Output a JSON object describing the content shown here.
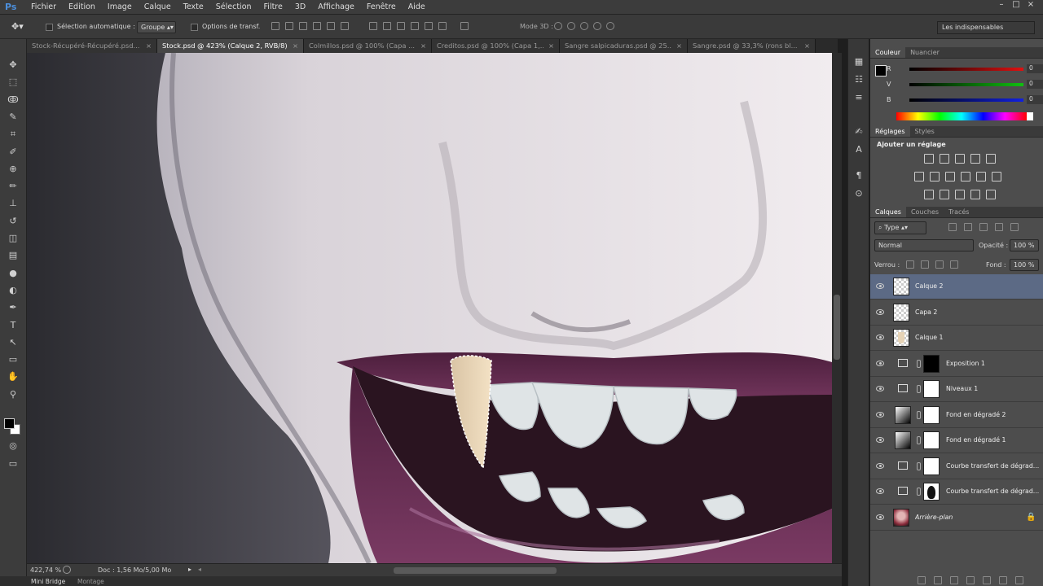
{
  "app": {
    "logo": "Ps"
  },
  "menu": [
    "Fichier",
    "Edition",
    "Image",
    "Calque",
    "Texte",
    "Sélection",
    "Filtre",
    "3D",
    "Affichage",
    "Fenêtre",
    "Aide"
  ],
  "window_controls": [
    "–",
    "□",
    "×"
  ],
  "options": {
    "auto_select_label": "Sélection automatique :",
    "auto_select_value": "Groupe",
    "transform_label": "Options de transf.",
    "mode3d_label": "Mode 3D :"
  },
  "workspace": "Les indispensables",
  "tabs": [
    {
      "label": "Stock-Récupéré-Récupéré.psd...",
      "active": false
    },
    {
      "label": "Stock.psd @ 423% (Calque 2, RVB/8) *",
      "active": true
    },
    {
      "label": "Colmillos.psd @ 100% (Capa ...",
      "active": false
    },
    {
      "label": "Creditos.psd @ 100% (Capa 1,...",
      "active": false
    },
    {
      "label": "Sangre salpicaduras.psd @ 25...",
      "active": false
    },
    {
      "label": "Sangre.psd @ 33,3% (rons bl...",
      "active": false
    }
  ],
  "status": {
    "zoom": "422,74 %",
    "doc": "Doc : 1,56 Mo/5,00 Mo"
  },
  "bottom_tabs": [
    "Mini Bridge",
    "Montage"
  ],
  "color_panel": {
    "tabs": [
      "Couleur",
      "Nuancier"
    ],
    "sliders": [
      {
        "label": "R",
        "value": "0"
      },
      {
        "label": "V",
        "value": "0"
      },
      {
        "label": "B",
        "value": "0"
      }
    ],
    "slider_colors": [
      "#e01010",
      "#10c010",
      "#1020e0"
    ]
  },
  "adjust_panel": {
    "tabs": [
      "Réglages",
      "Styles"
    ],
    "title": "Ajouter un réglage"
  },
  "layers_panel": {
    "tabs": [
      "Calques",
      "Couches",
      "Tracés"
    ],
    "filter": "Type",
    "blend_mode": "Normal",
    "opacity_label": "Opacité :",
    "opacity_value": "100 %",
    "lock_label": "Verrou :",
    "fill_label": "Fond :",
    "fill_value": "100 %",
    "layers": [
      {
        "name": "Calque 2",
        "selected": true,
        "thumb": "checker",
        "mask": false
      },
      {
        "name": "Capa 2",
        "selected": false,
        "thumb": "checker",
        "mask": false
      },
      {
        "name": "Calque 1",
        "selected": false,
        "thumb": "fang",
        "mask": false
      },
      {
        "name": "Exposition 1",
        "selected": false,
        "thumb": "adj",
        "mask": "black"
      },
      {
        "name": "Niveaux 1",
        "selected": false,
        "thumb": "adj",
        "mask": "white"
      },
      {
        "name": "Fond en dégradé 2",
        "selected": false,
        "thumb": "gradient",
        "mask": "white"
      },
      {
        "name": "Fond en dégradé 1",
        "selected": false,
        "thumb": "gradient",
        "mask": "white"
      },
      {
        "name": "Courbe transfert de dégrad...",
        "selected": false,
        "thumb": "adj",
        "mask": "white"
      },
      {
        "name": "Courbe transfert de dégrad...",
        "selected": false,
        "thumb": "adj",
        "mask": "face"
      },
      {
        "name": "Arrière-plan",
        "selected": false,
        "thumb": "photo",
        "mask": false,
        "locked": true
      }
    ]
  }
}
